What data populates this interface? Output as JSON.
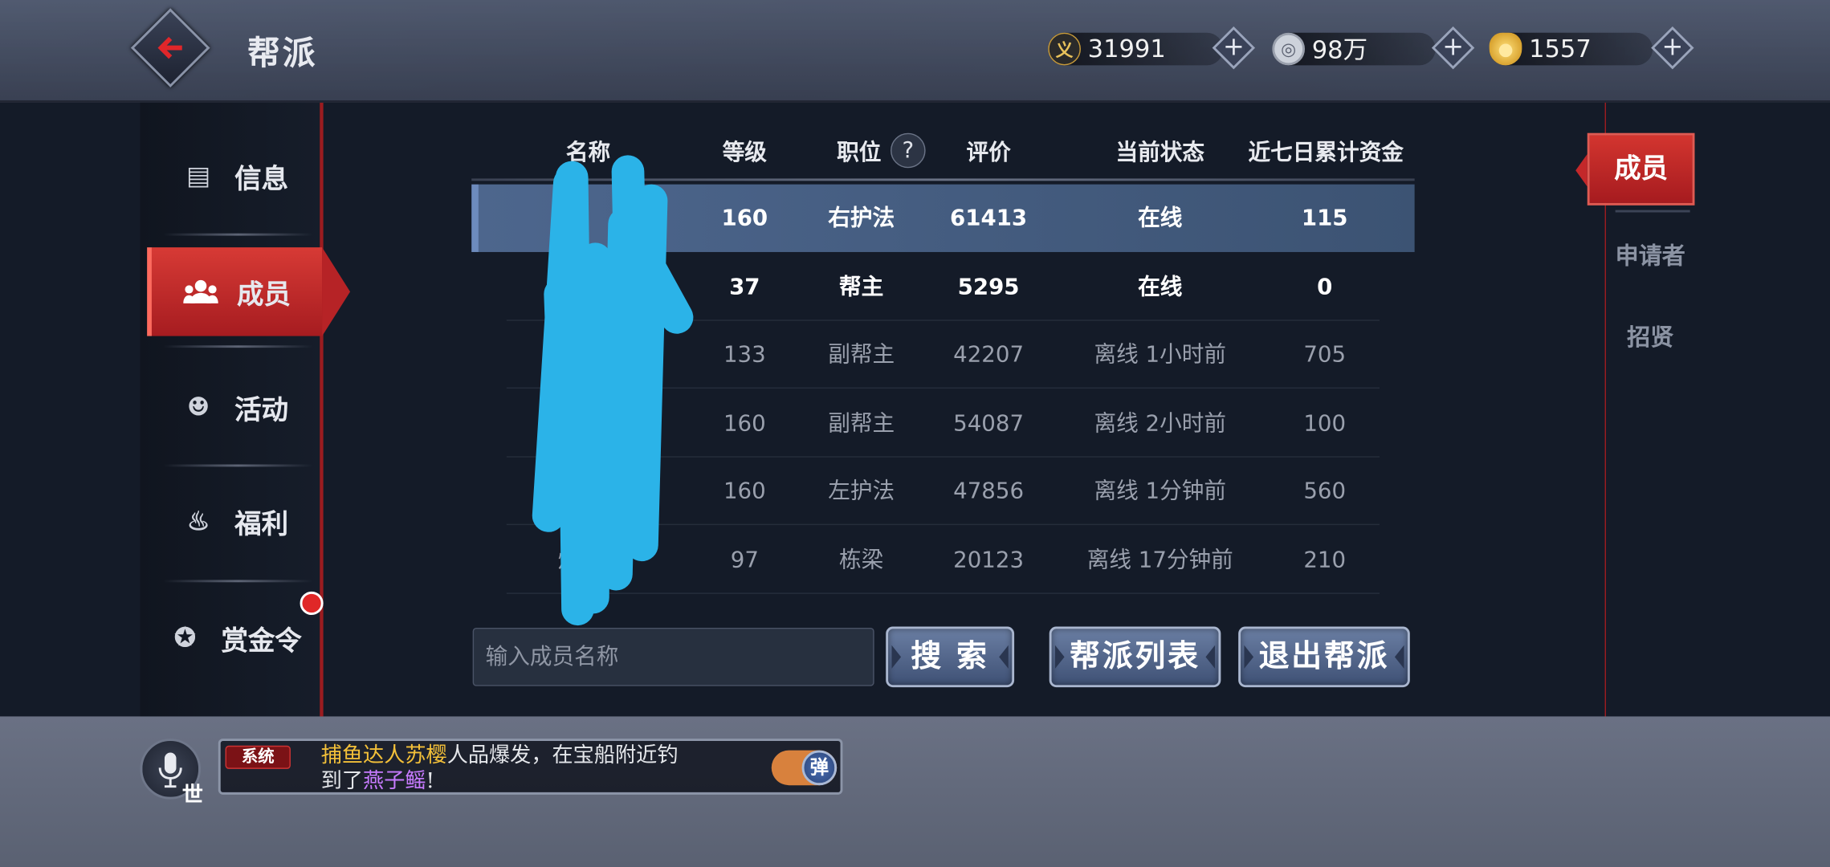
{
  "header": {
    "title": "帮派"
  },
  "currencies": [
    {
      "icon": "yi-token-icon",
      "glyph": "义",
      "value": "31991"
    },
    {
      "icon": "silver-coin-icon",
      "glyph": "◎",
      "value": "98万"
    },
    {
      "icon": "gold-ingot-icon",
      "glyph": "●",
      "value": "1557"
    }
  ],
  "plus_label": "+",
  "sidebar": {
    "items": [
      {
        "label": "信息",
        "icon": "id-card-icon",
        "glyph": "▤"
      },
      {
        "label": "成员",
        "icon": "members-icon",
        "glyph": "👥"
      },
      {
        "label": "活动",
        "icon": "mask-icon",
        "glyph": "☻"
      },
      {
        "label": "福利",
        "icon": "gift-bag-icon",
        "glyph": "♨"
      },
      {
        "label": "赏金令",
        "icon": "bounty-token-icon",
        "glyph": "✪"
      }
    ]
  },
  "table": {
    "headers": [
      "名称",
      "等级",
      "职位",
      "评价",
      "当前状态",
      "近七日累计资金"
    ],
    "help": "?",
    "rows": [
      {
        "name": "",
        "level": "160",
        "position": "右护法",
        "rating": "61413",
        "status": "在线",
        "funds": "115"
      },
      {
        "name": "",
        "level": "37",
        "position": "帮主",
        "rating": "5295",
        "status": "在线",
        "funds": "0"
      },
      {
        "name": "",
        "level": "133",
        "position": "副帮主",
        "rating": "42207",
        "status": "离线 1小时前",
        "funds": "705"
      },
      {
        "name": "",
        "level": "160",
        "position": "副帮主",
        "rating": "54087",
        "status": "离线 2小时前",
        "funds": "100"
      },
      {
        "name": "",
        "level": "160",
        "position": "左护法",
        "rating": "47856",
        "status": "离线 1分钟前",
        "funds": "560"
      },
      {
        "name": "烽      猴",
        "level": "97",
        "position": "栋梁",
        "rating": "20123",
        "status": "离线 17分钟前",
        "funds": "210"
      }
    ]
  },
  "search": {
    "placeholder": "输入成员名称",
    "button": "搜 索"
  },
  "actions": {
    "guild_list": "帮派列表",
    "leave_guild": "退出帮派"
  },
  "right_tabs": {
    "active": "成员",
    "applicants": "申请者",
    "recruit": "招贤"
  },
  "chat": {
    "channel": "系统",
    "name": "捕鱼达人苏樱",
    "text1": "人品爆发，在宝船附近钓",
    "text2": "到了",
    "item": "燕子鳐",
    "text3": "!",
    "toggle": "弹",
    "world": "世"
  },
  "colors": {
    "accent_red": "#b62326",
    "highlight_row": "#4d668d",
    "gold_text": "#f3c039",
    "purple_text": "#c77bff",
    "censor_blue": "#2bb3e8"
  }
}
